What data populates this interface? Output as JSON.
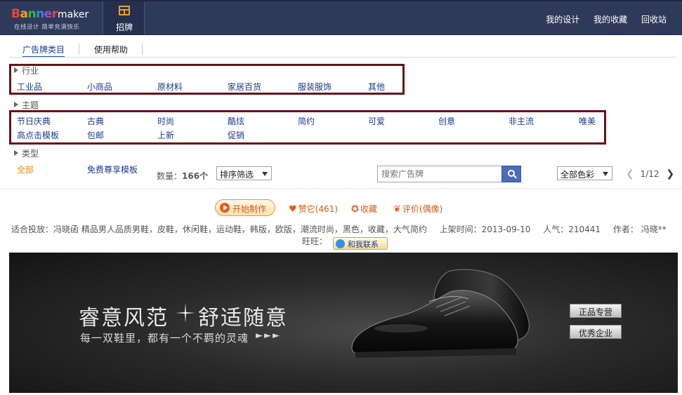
{
  "header": {
    "logo_letters": [
      "B",
      "a",
      "n",
      "n",
      "e",
      "r"
    ],
    "logo_maker": "maker",
    "logo_sub": "在线设计  简单充满快乐",
    "nav_tab_label": "招牌",
    "links": [
      "我的设计",
      "我的收藏",
      "回收站"
    ]
  },
  "tabs": [
    "广告牌类目",
    "使用帮助"
  ],
  "sections": {
    "industry": {
      "title": "行业",
      "items": [
        "工业品",
        "小商品",
        "原材料",
        "家居百货",
        "服装服饰",
        "其他"
      ]
    },
    "theme": {
      "title": "主题",
      "row1": [
        "节日庆典",
        "古典",
        "时尚",
        "酷炫",
        "简约",
        "可爱",
        "创意",
        "非主流",
        "唯美"
      ],
      "row2": [
        "高点击模板",
        "包邮",
        "上新",
        "促销"
      ]
    },
    "type": {
      "title": "类型",
      "items": [
        "全部",
        "免费尊享模板"
      ]
    }
  },
  "filter": {
    "count_prefix": "数量：",
    "count": "166个",
    "sort_label": "排序筛选",
    "search_placeholder": "搜索广告牌",
    "color_label": "全部色彩",
    "page": "1/12"
  },
  "actions": {
    "start": "开始制作",
    "like": "赞它(461)",
    "favorite": "收藏",
    "review": "评价(偶像)"
  },
  "info": {
    "usage": "适合投放：冯晓函 精品男人品质男鞋，皮鞋，休闲鞋，运动鞋，韩版，欧版，潮流时尚，黑色，收藏，大气简约",
    "listed": "上架时间：2013-09-10",
    "popularity": "人气：210441",
    "author": "作者：  冯晓**",
    "wangwang_label": "旺旺：",
    "contact_label": "和我联系"
  },
  "banner": {
    "title_left": "睿意风范",
    "title_right": "舒适随意",
    "subtitle": "每一双鞋里，都有一个不羁的灵魂",
    "arrows": "►►►",
    "badge1": "正品专营",
    "badge2": "优秀企业"
  },
  "colors": {
    "header_bg": "#2f3a5a",
    "link_blue": "#1a3a8c",
    "accent_orange": "#e88a1a",
    "highlight_box": "#6b1117"
  }
}
